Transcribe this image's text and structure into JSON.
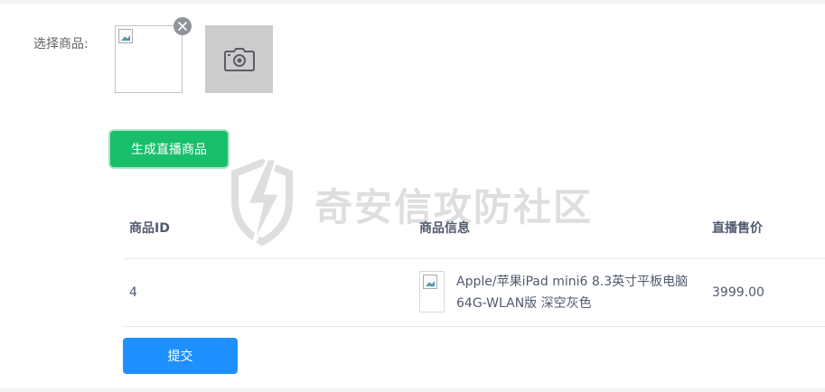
{
  "form": {
    "select_label": "选择商品:",
    "generate_button": "生成直播商品",
    "submit_button": "提交"
  },
  "watermark": {
    "text": "奇安信攻防社区"
  },
  "table": {
    "headers": {
      "id": "商品ID",
      "info": "商品信息",
      "price": "直播售价"
    },
    "rows": [
      {
        "id": "4",
        "name": "Apple/苹果iPad mini6 8.3英寸平板电脑 64G-WLAN版 深空灰色",
        "price": "3999.00"
      }
    ]
  },
  "icons": {
    "remove": "close-icon",
    "upload": "camera-icon",
    "broken_image": "broken-image-icon"
  },
  "colors": {
    "generate_button": "#19be6b",
    "submit_button": "#1e90ff",
    "upload_box": "#cccccc"
  }
}
